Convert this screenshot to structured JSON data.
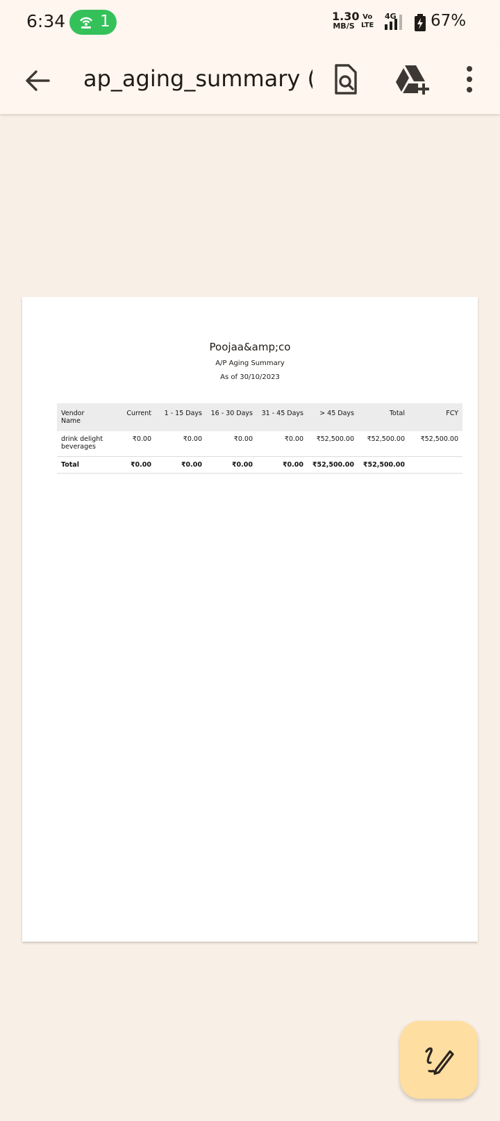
{
  "status_bar": {
    "time": "6:34",
    "hotspot_count": "1",
    "net_speed_value": "1.30",
    "net_speed_unit": "MB/S",
    "volte_top": "Vo",
    "volte_bottom": "LTE",
    "network_type": "4G",
    "battery_percent": "67%"
  },
  "app_bar": {
    "title": "ap_aging_summary (...",
    "icons": [
      "back-arrow-icon",
      "find-in-document-icon",
      "save-to-drive-icon",
      "more-vert-icon"
    ]
  },
  "document": {
    "company": "Poojaa&amp;co",
    "report_name": "A/P Aging Summary",
    "report_date": "As of 30/10/2023",
    "table": {
      "headers": [
        "Vendor\nName",
        "Current",
        "1 - 15 Days",
        "16 - 30 Days",
        "31 - 45 Days",
        "> 45 Days",
        "Total",
        "FCY"
      ],
      "rows": [
        [
          "drink delight beverages",
          "₹0.00",
          "₹0.00",
          "₹0.00",
          "₹0.00",
          "₹52,500.00",
          "₹52,500.00",
          "₹52,500.00"
        ]
      ],
      "total_row": [
        "Total",
        "₹0.00",
        "₹0.00",
        "₹0.00",
        "₹0.00",
        "₹52,500.00",
        "₹52,500.00",
        ""
      ]
    }
  },
  "fab": {
    "icon": "edit-annotate-icon"
  },
  "colors": {
    "background": "#f8efe6",
    "app_bar": "#fff6ef",
    "hotspot_green": "#35c15a",
    "fab": "#ffdea1",
    "table_header": "#ececec"
  }
}
